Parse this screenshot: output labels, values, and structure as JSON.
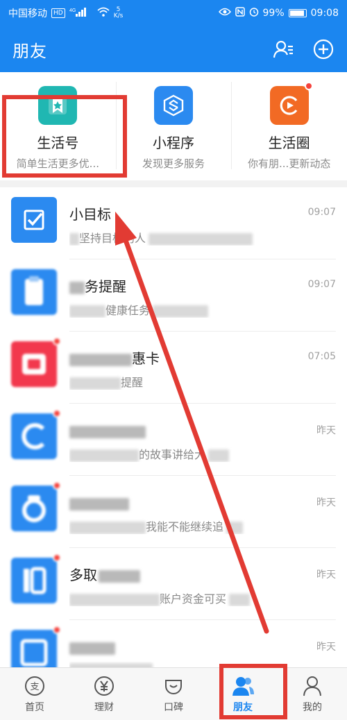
{
  "status_bar": {
    "carrier": "中国移动",
    "hd": "HD",
    "net_speed_value": "5",
    "net_speed_unit": "K/s",
    "network": "4G",
    "battery": "99%",
    "time": "09:08"
  },
  "header": {
    "title": "朋友",
    "contacts_icon": "contacts-icon",
    "add_icon": "plus-circle-icon"
  },
  "tiles": [
    {
      "name": "生活号",
      "sub": "简单生活更多优...",
      "color": "#20b7b2",
      "icon": "life-account-icon"
    },
    {
      "name": "小程序",
      "sub": "发现更多服务",
      "color": "#2b8af0",
      "icon": "mini-program-icon"
    },
    {
      "name": "生活圈",
      "sub": "你有朋...更新动态",
      "color": "#f26a24",
      "icon": "life-circle-icon",
      "badge": true
    }
  ],
  "messages": [
    {
      "name": "小目标",
      "preview": "坚持目标的人",
      "time": "09:07",
      "color": "#2b8af0"
    },
    {
      "name": "务提醒",
      "preview": "健康任务",
      "time": "09:07",
      "color": "#2b8af0"
    },
    {
      "name": "惠卡",
      "preview": "提醒",
      "time": "07:05",
      "color": "#f2384d"
    },
    {
      "name": "",
      "preview": "的故事讲给大",
      "time": "昨天",
      "color": "#2b8af0"
    },
    {
      "name": "",
      "preview": "我能不能继续追",
      "time": "昨天",
      "color": "#2b8af0"
    },
    {
      "name": "多取",
      "preview": "账户资金可买",
      "time": "昨天",
      "color": "#2b8af0"
    },
    {
      "name": "",
      "preview": "",
      "time": "昨天",
      "color": "#2b8af0"
    }
  ],
  "tabbar": [
    {
      "label": "首页",
      "icon": "alipay-home-icon",
      "active": false
    },
    {
      "label": "理财",
      "icon": "yuan-icon",
      "active": false
    },
    {
      "label": "口碑",
      "icon": "koubei-icon",
      "active": false
    },
    {
      "label": "朋友",
      "icon": "friends-icon",
      "active": true
    },
    {
      "label": "我的",
      "icon": "person-icon",
      "active": false
    }
  ],
  "annotations": {
    "color": "#e23b33"
  }
}
